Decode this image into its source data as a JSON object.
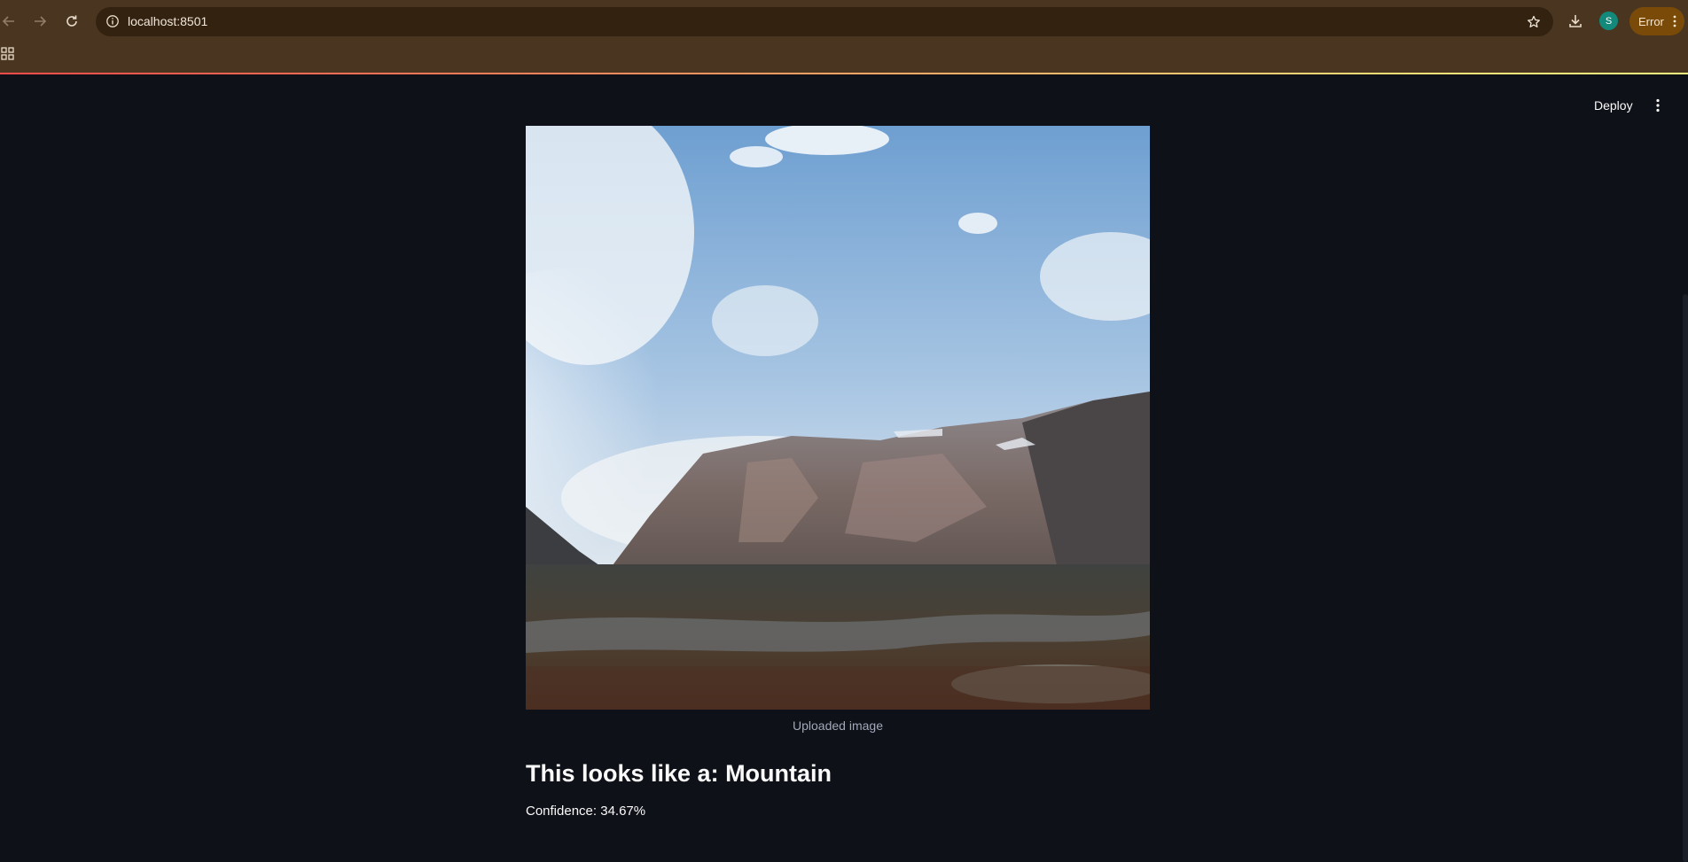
{
  "browser": {
    "url": "localhost:8501",
    "profile_initial": "S",
    "error_label": "Error",
    "accent_colors": {
      "frame": "#4a3620",
      "omnibox": "#32220f",
      "avatar": "#12897a",
      "error_chip": "#7a4a08"
    }
  },
  "toolbar_icons": [
    "back-icon",
    "forward-icon",
    "reload-icon",
    "site-info-icon",
    "bookmark-star-icon",
    "download-icon",
    "menu-dots-icon",
    "apps-grid-icon"
  ],
  "streamlit": {
    "deploy_label": "Deploy",
    "theme": {
      "background": "#0e1117",
      "text": "#fafafa",
      "caption": "#a3a8b8"
    }
  },
  "content": {
    "image_caption": "Uploaded image",
    "heading": "This looks like a: Mountain",
    "confidence": "Confidence: 34.67%"
  }
}
